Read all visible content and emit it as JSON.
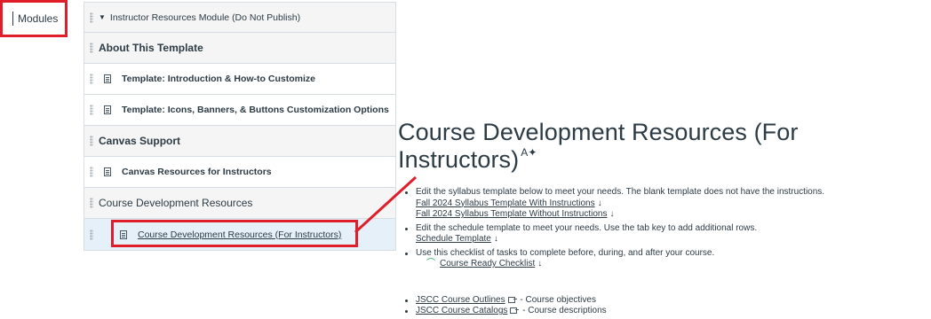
{
  "nav": {
    "modules_label": "Modules"
  },
  "modules": {
    "instructor_module": "Instructor Resources Module (Do Not Publish)",
    "about_header": "About This Template",
    "intro_item": "Template: Introduction & How-to Customize",
    "icons_item": "Template: Icons, Banners, & Buttons Customization Options",
    "canvas_header": "Canvas Support",
    "canvas_item": "Canvas Resources for Instructors",
    "course_dev_header": "Course Development Resources",
    "course_dev_item": "Course Development Resources (For Instructors)"
  },
  "content": {
    "title": "Course Development Resources (For Instructors)",
    "title_icon": "ai-sparkle-icon",
    "bullets": {
      "syllabus_text": "Edit the syllabus template below to meet your needs. The blank template does not have the instructions.",
      "syllabus_with": "Fall 2024 Syllabus Template With Instructions",
      "syllabus_without": "Fall 2024 Syllabus Template Without Instructions",
      "schedule_text": "Edit the schedule template to meet your needs. Use the tab key to add additional rows.",
      "schedule_link": "Schedule Template",
      "checklist_text": "Use this checklist of tasks to complete before, during, and after your course.",
      "checklist_link": "Course Ready Checklist",
      "outlines_link": "JSCC Course Outlines",
      "outlines_desc": "- Course objectives",
      "catalogs_link": "JSCC Course Catalogs",
      "catalogs_desc": "- Course descriptions"
    },
    "download_glyph": "↓"
  },
  "colors": {
    "highlight": "#e01e2a",
    "active_row": "#e6f0f9",
    "header_bg": "#f5f5f5",
    "check": "#1e9e5a"
  }
}
